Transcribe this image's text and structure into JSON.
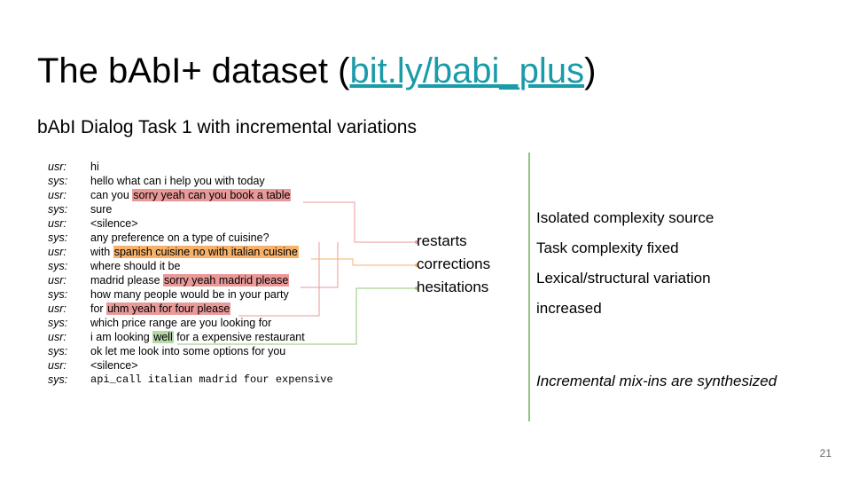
{
  "slide": {
    "title_prefix": "The bAbI+ dataset (",
    "title_link": "bit.ly/babi_plus",
    "title_suffix": ")",
    "subtitle": "bAbI Dialog Task 1 with incremental variations",
    "page_number": "21"
  },
  "dialog": [
    {
      "speaker": "usr:",
      "before": "hi",
      "highlight": "",
      "after": ""
    },
    {
      "speaker": "sys:",
      "before": "hello what can i help you with today",
      "highlight": "",
      "after": ""
    },
    {
      "speaker": "usr:",
      "before": "can you ",
      "highlight": "sorry yeah can you book a table",
      "after": ""
    },
    {
      "speaker": "sys:",
      "before": "sure",
      "highlight": "",
      "after": ""
    },
    {
      "speaker": "usr:",
      "before": "<silence>",
      "highlight": "",
      "after": ""
    },
    {
      "speaker": "sys:",
      "before": "any preference on a type of cuisine?",
      "highlight": "",
      "after": ""
    },
    {
      "speaker": "usr:",
      "before": "with ",
      "highlight": "spanish cuisine no with italian cuisine",
      "after": ""
    },
    {
      "speaker": "sys:",
      "before": "where should it be",
      "highlight": "",
      "after": ""
    },
    {
      "speaker": "usr:",
      "before": "madrid please ",
      "highlight": "sorry yeah madrid please",
      "after": ""
    },
    {
      "speaker": "sys:",
      "before": "how many people would be in your party",
      "highlight": "",
      "after": ""
    },
    {
      "speaker": "usr:",
      "before": "for ",
      "highlight": "uhm yeah for four please",
      "after": ""
    },
    {
      "speaker": "sys:",
      "before": "which price range are you looking for",
      "highlight": "",
      "after": ""
    },
    {
      "speaker": "usr:",
      "before": "i am looking ",
      "highlight": "well",
      "after": " for a expensive restaurant"
    },
    {
      "speaker": "sys:",
      "before": "ok let me look into some options for you",
      "highlight": "",
      "after": ""
    },
    {
      "speaker": "usr:",
      "before": "<silence>",
      "highlight": "",
      "after": ""
    },
    {
      "speaker": "sys:",
      "before": "api_call italian madrid four expensive",
      "highlight": "",
      "after": ""
    }
  ],
  "labels": {
    "restarts": "restarts",
    "corrections": "corrections",
    "hesitations": "hesitations"
  },
  "colors": {
    "link": "#1a9ba8",
    "restart": "#ea9999",
    "correction": "#f6b26b",
    "hesitation": "#b6d7a8",
    "divider": "#93c47d"
  },
  "points": [
    "Isolated complexity source",
    "Task complexity fixed",
    "Lexical/structural variation",
    "increased",
    "Incremental mix-ins are synthesized"
  ]
}
